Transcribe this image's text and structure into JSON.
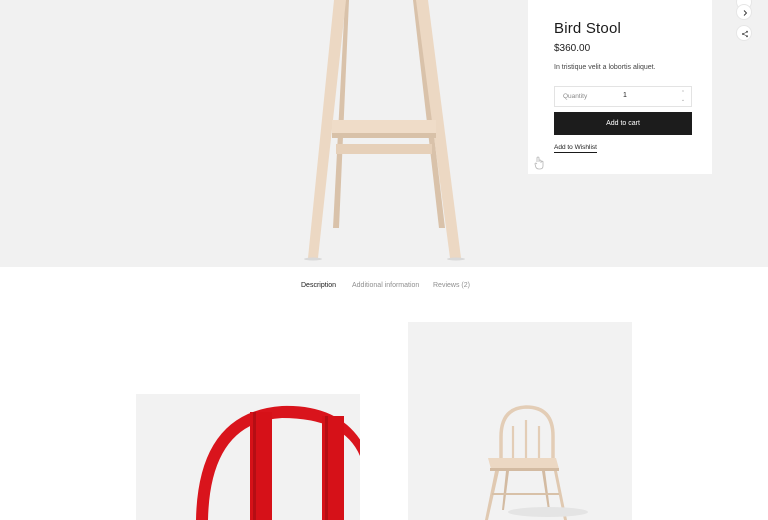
{
  "product": {
    "title": "Bird Stool",
    "price": "$360.00",
    "short_description": "In tristique velit a lobortis aliquet."
  },
  "quantity": {
    "label": "Quantity",
    "value": "1"
  },
  "actions": {
    "add_to_cart": "Add to cart",
    "add_to_wishlist": "Add to Wishlist"
  },
  "tabs": [
    {
      "label": "Description",
      "active": true
    },
    {
      "label": "Additional information",
      "active": false
    },
    {
      "label": "Reviews (2)",
      "active": false
    }
  ],
  "icons": {
    "next": "chevron-right-icon",
    "share": "share-icon",
    "pointer": "hand-pointer-icon"
  },
  "colors": {
    "hero_background": "#f1f1f1",
    "button_background": "#1c1c1c",
    "wood": "#e8d3bd",
    "red_chair": "#d9141c"
  }
}
